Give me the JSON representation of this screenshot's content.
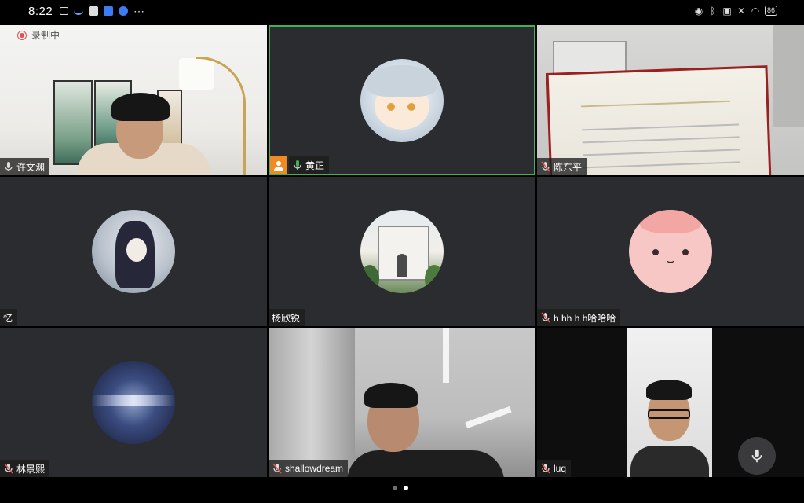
{
  "status_bar": {
    "time": "8:22",
    "more": "⋯",
    "battery": "86"
  },
  "recording": {
    "label": "录制中"
  },
  "participants": [
    {
      "name": "许文渊",
      "mic": "on"
    },
    {
      "name": "黄正",
      "mic": "speaking",
      "active": true
    },
    {
      "name": "陈东平",
      "mic": "muted"
    },
    {
      "name": "忆",
      "mic": "none"
    },
    {
      "name": "杨欣锐",
      "mic": "none"
    },
    {
      "name": "h hh h h哈哈哈",
      "mic": "muted"
    },
    {
      "name": "林景熙",
      "mic": "muted"
    },
    {
      "name": "shallowdream",
      "mic": "muted"
    },
    {
      "name": "luq",
      "mic": "muted"
    }
  ],
  "colors": {
    "speaking": "#3fb34f",
    "muted": "#e05a5a",
    "tile_bg": "#2b2c2f",
    "host_badge": "#f08a24"
  },
  "pager": {
    "pages": 2,
    "current": 2
  }
}
